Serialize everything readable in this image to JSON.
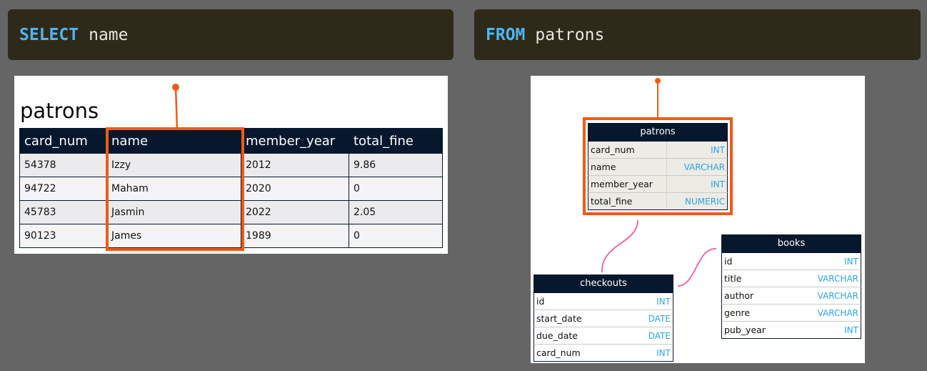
{
  "query": {
    "select_keyword": "SELECT",
    "select_rest": "name",
    "from_keyword": "FROM",
    "from_rest": "patrons"
  },
  "table": {
    "title": "patrons",
    "columns": [
      "card_num",
      "name",
      "member_year",
      "total_fine"
    ],
    "rows": [
      [
        "54378",
        "Izzy",
        "2012",
        "9.86"
      ],
      [
        "94722",
        "Maham",
        "2020",
        "0"
      ],
      [
        "45783",
        "Jasmin",
        "2022",
        "2.05"
      ],
      [
        "90123",
        "James",
        "1989",
        "0"
      ]
    ],
    "highlighted_column": "name"
  },
  "schema": {
    "patrons": {
      "title": "patrons",
      "fields": [
        {
          "name": "card_num",
          "type": "INT"
        },
        {
          "name": "name",
          "type": "VARCHAR"
        },
        {
          "name": "member_year",
          "type": "INT"
        },
        {
          "name": "total_fine",
          "type": "NUMERIC"
        }
      ]
    },
    "checkouts": {
      "title": "checkouts",
      "fields": [
        {
          "name": "id",
          "type": "INT"
        },
        {
          "name": "start_date",
          "type": "DATE"
        },
        {
          "name": "due_date",
          "type": "DATE"
        },
        {
          "name": "card_num",
          "type": "INT"
        }
      ]
    },
    "books": {
      "title": "books",
      "fields": [
        {
          "name": "id",
          "type": "INT"
        },
        {
          "name": "title",
          "type": "VARCHAR"
        },
        {
          "name": "author",
          "type": "VARCHAR"
        },
        {
          "name": "genre",
          "type": "VARCHAR"
        },
        {
          "name": "pub_year",
          "type": "INT"
        }
      ]
    },
    "highlighted_table": "patrons"
  },
  "colors": {
    "highlight": "#f25a14",
    "relation_line": "#f06aa8",
    "header_bg": "#07182e",
    "keyword": "#4fb6ef",
    "type_text": "#2ea3e8"
  }
}
